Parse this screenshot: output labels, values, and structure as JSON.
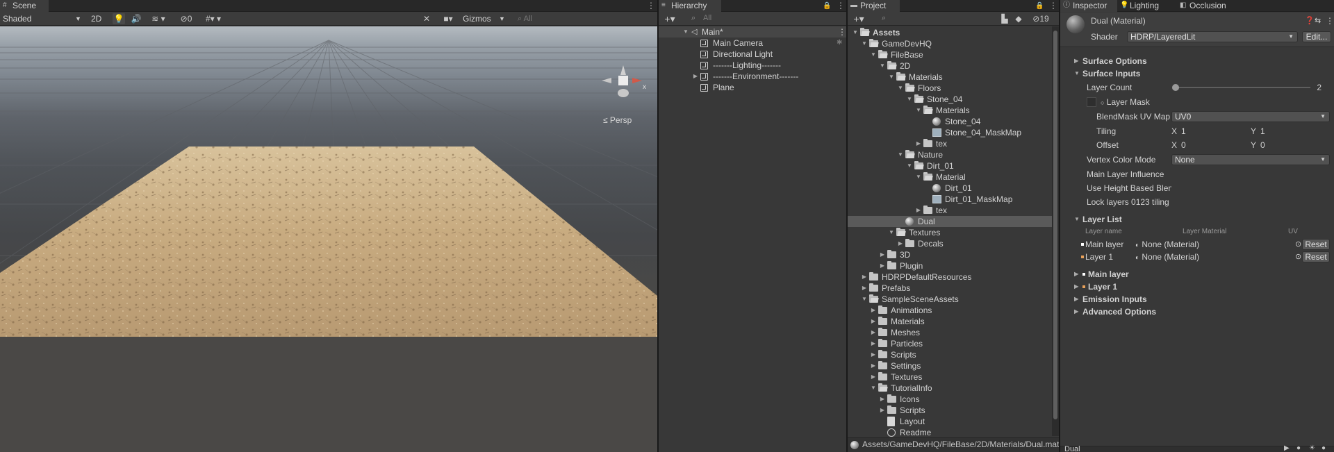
{
  "scene": {
    "tab": "Scene",
    "shading_mode": "Shaded",
    "btn_2d": "2D",
    "hidden_count": "0",
    "gizmos_label": "Gizmos",
    "search_placeholder": "All",
    "persp_label": "Persp",
    "gizmo_axis_x": "x"
  },
  "hierarchy": {
    "tab": "Hierarchy",
    "search_placeholder": "All",
    "scene_name": "Main*",
    "items": [
      "Main Camera",
      "Directional Light",
      "-------Lighting-------",
      "-------Environment-------",
      "Plane"
    ]
  },
  "project": {
    "tab": "Project",
    "hidden_count": "19",
    "tree": [
      "Assets",
      "GameDevHQ",
      "FileBase",
      "2D",
      "Materials",
      "Floors",
      "Stone_04",
      "Materials",
      "Stone_04",
      "Stone_04_MaskMap",
      "tex",
      "Nature",
      "Dirt_01",
      "Material",
      "Dirt_01",
      "Dirt_01_MaskMap",
      "tex",
      "Dual",
      "Textures",
      "Decals",
      "3D",
      "Plugin",
      "HDRPDefaultResources",
      "Prefabs",
      "SampleSceneAssets",
      "Animations",
      "Materials",
      "Meshes",
      "Particles",
      "Scripts",
      "Settings",
      "Textures",
      "TutorialInfo",
      "Icons",
      "Scripts",
      "Layout",
      "Readme"
    ],
    "path": "Assets/GameDevHQ/FileBase/2D/Materials/Dual.mat"
  },
  "inspector": {
    "tabs": [
      "Inspector",
      "Lighting",
      "Occlusion"
    ],
    "object_title": "Dual (Material)",
    "shader_label": "Shader",
    "shader_value": "HDRP/LayeredLit",
    "edit_button": "Edit...",
    "sections": {
      "surface_options": "Surface Options",
      "surface_inputs": "Surface Inputs",
      "layer_list": "Layer List",
      "main_layer": "Main layer",
      "layer_1": "Layer 1",
      "emission_inputs": "Emission Inputs",
      "advanced_options": "Advanced Options"
    },
    "layer_count_label": "Layer Count",
    "layer_count_value": "2",
    "layer_count_slider_fraction": 0.0,
    "layer_mask_label": "Layer Mask",
    "blendmask_label": "BlendMask UV Map",
    "blendmask_value": "UV0",
    "tiling_label": "Tiling",
    "tiling_x": "1",
    "tiling_y": "1",
    "offset_label": "Offset",
    "offset_x": "0",
    "offset_y": "0",
    "axis_x": "X",
    "axis_y": "Y",
    "vertex_color_label": "Vertex Color Mode",
    "vertex_color_value": "None",
    "main_layer_influence": "Main Layer Influence",
    "use_height_based": "Use Height Based Blend",
    "lock_layers": "Lock layers 0123 tiling",
    "layer_list": {
      "col_name": "Layer name",
      "col_material": "Layer Material",
      "col_uv": "UV",
      "rows": [
        {
          "name": "Main layer",
          "material": "None (Material)",
          "reset": "Reset",
          "color": "#ffffff"
        },
        {
          "name": "Layer 1",
          "material": "None (Material)",
          "reset": "Reset",
          "color": "#e8a15a"
        }
      ]
    },
    "preview_name": "Dual"
  }
}
